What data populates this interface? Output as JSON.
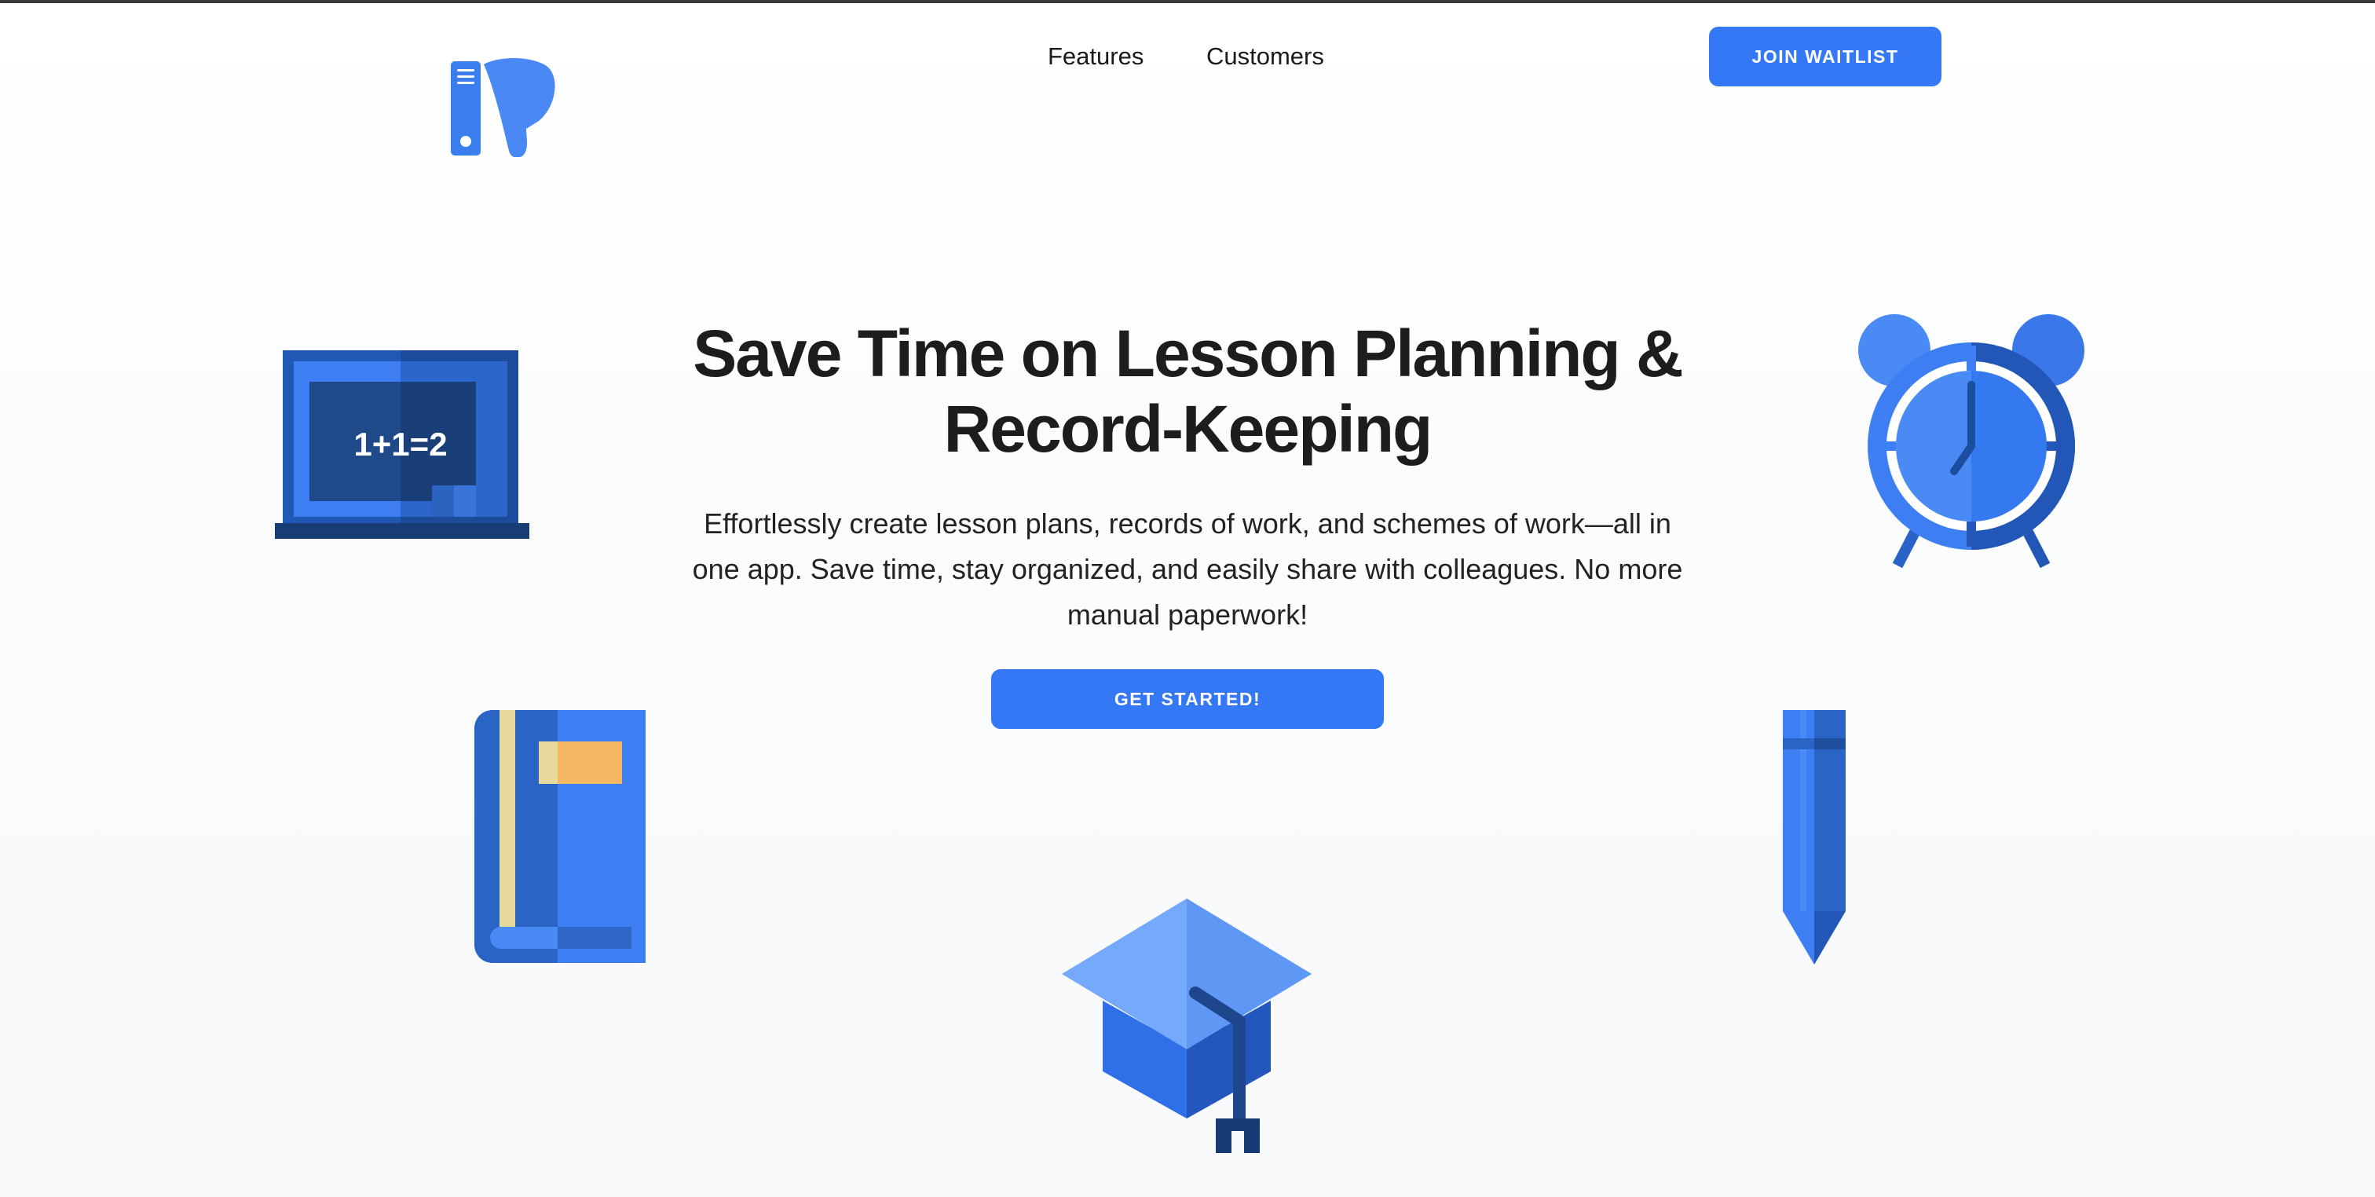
{
  "nav": {
    "links": [
      {
        "label": "Features"
      },
      {
        "label": "Customers"
      }
    ],
    "waitlist_label": "JOIN WAITLIST"
  },
  "hero": {
    "title": "Save Time on Lesson Planning & Record-Keeping",
    "subtitle": "Effortlessly create lesson plans, records of work, and schemes of work—all in one app. Save time, stay organized, and easily share with colleagues. No more manual paperwork!",
    "cta_label": "GET STARTED!"
  },
  "illustrations": {
    "chalkboard_text": "1+1=2"
  },
  "colors": {
    "accent": "#3478f6",
    "text": "#1d1d1f",
    "icon_blue": "#3d7ff2",
    "icon_dark": "#1f4a9c",
    "book_tab": "#f3b861"
  }
}
